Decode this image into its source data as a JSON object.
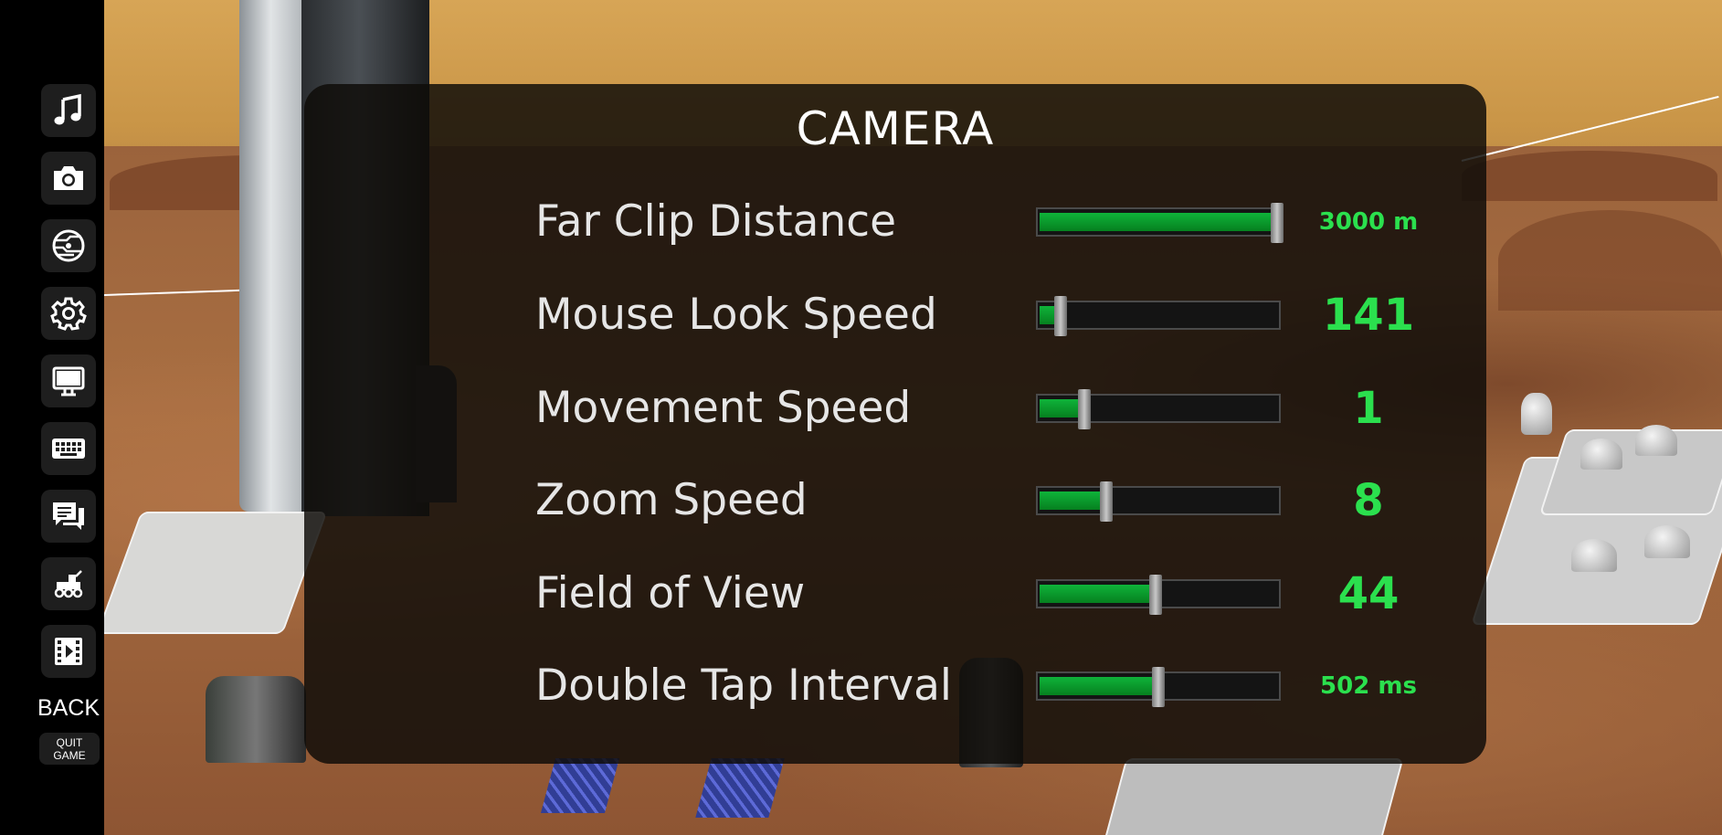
{
  "sidebar": {
    "items": [
      {
        "icon": "music-icon"
      },
      {
        "icon": "camera-icon"
      },
      {
        "icon": "planet-icon"
      },
      {
        "icon": "gear-icon"
      },
      {
        "icon": "monitor-icon"
      },
      {
        "icon": "keyboard-icon"
      },
      {
        "icon": "chat-icon"
      },
      {
        "icon": "rover-icon"
      },
      {
        "icon": "film-icon"
      }
    ],
    "back_label": "BACK",
    "quit_label": "QUIT GAME"
  },
  "panel": {
    "title": "CAMERA",
    "settings": [
      {
        "label": "Far Clip Distance",
        "value": "3000 m",
        "fill": 1.0,
        "value_size": "small"
      },
      {
        "label": "Mouse Look Speed",
        "value": "141",
        "fill": 0.09,
        "value_size": "big"
      },
      {
        "label": "Movement Speed",
        "value": "1",
        "fill": 0.19,
        "value_size": "big"
      },
      {
        "label": "Zoom Speed",
        "value": "8",
        "fill": 0.28,
        "value_size": "big"
      },
      {
        "label": "Field of View",
        "value": "44",
        "fill": 0.49,
        "value_size": "big"
      },
      {
        "label": "Double Tap Interval",
        "value": "502 ms",
        "fill": 0.5,
        "value_size": "small"
      }
    ]
  },
  "colors": {
    "accent_green": "#2be04e",
    "slider_fill": "#0fb33a",
    "panel_bg": "#0e0c08"
  }
}
